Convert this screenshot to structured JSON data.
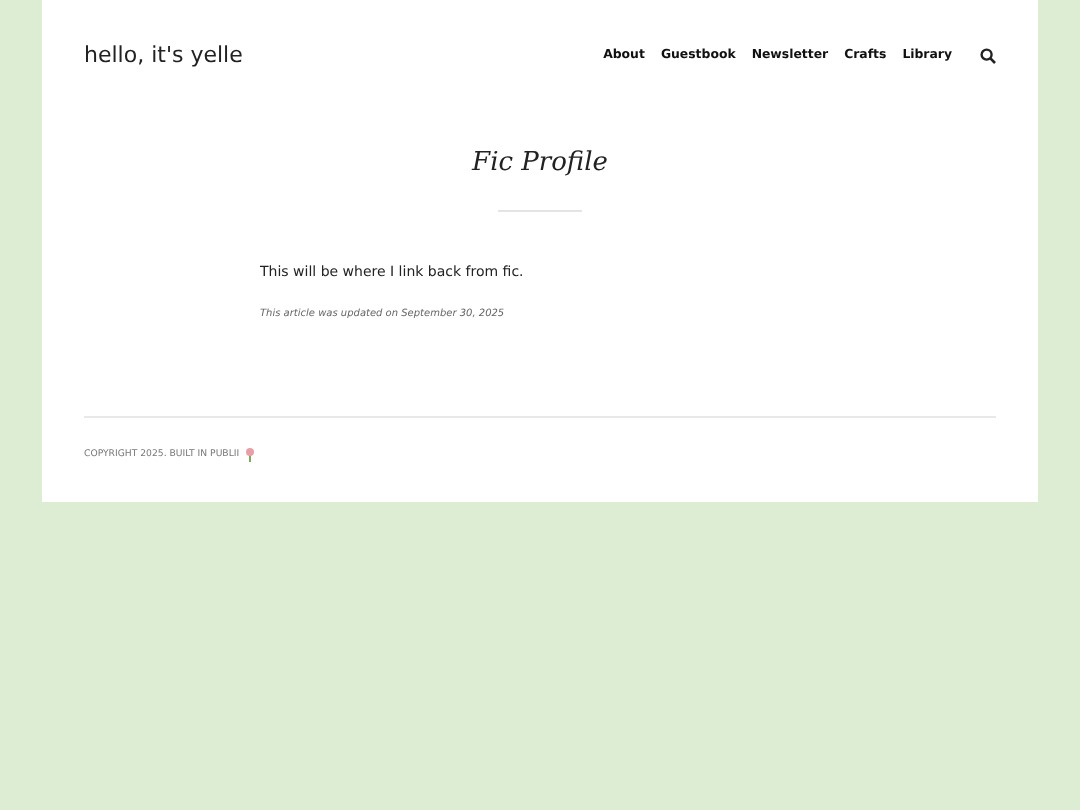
{
  "site_title": "hello, it's yelle",
  "nav": [
    {
      "label": "About"
    },
    {
      "label": "Guestbook"
    },
    {
      "label": "Newsletter"
    },
    {
      "label": "Crafts"
    },
    {
      "label": "Library"
    }
  ],
  "page_title": "Fic Profile",
  "body": "This will be where I link back from fic.",
  "updated": "This article was updated on September 30, 2025",
  "copyright": "COPYRIGHT 2025. BUILT IN PUBLII"
}
